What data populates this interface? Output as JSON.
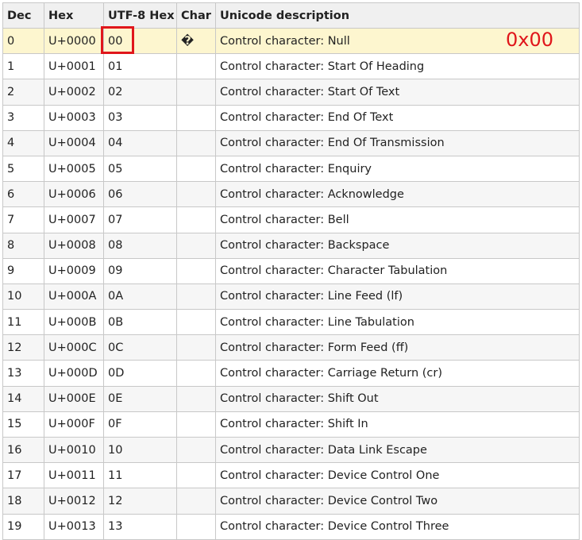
{
  "table": {
    "headers": [
      "Dec",
      "Hex",
      "UTF-8 Hex",
      "Char",
      "Unicode description"
    ],
    "rows": [
      [
        "0",
        "U+0000",
        "00",
        "�",
        "Control character: Null"
      ],
      [
        "1",
        "U+0001",
        "01",
        "",
        "Control character: Start Of Heading"
      ],
      [
        "2",
        "U+0002",
        "02",
        "",
        "Control character: Start Of Text"
      ],
      [
        "3",
        "U+0003",
        "03",
        "",
        "Control character: End Of Text"
      ],
      [
        "4",
        "U+0004",
        "04",
        "",
        "Control character: End Of Transmission"
      ],
      [
        "5",
        "U+0005",
        "05",
        "",
        "Control character: Enquiry"
      ],
      [
        "6",
        "U+0006",
        "06",
        "",
        "Control character: Acknowledge"
      ],
      [
        "7",
        "U+0007",
        "07",
        "",
        "Control character: Bell"
      ],
      [
        "8",
        "U+0008",
        "08",
        "",
        "Control character: Backspace"
      ],
      [
        "9",
        "U+0009",
        "09",
        "",
        "Control character: Character Tabulation"
      ],
      [
        "10",
        "U+000A",
        "0A",
        "",
        "Control character: Line Feed (lf)"
      ],
      [
        "11",
        "U+000B",
        "0B",
        "",
        "Control character: Line Tabulation"
      ],
      [
        "12",
        "U+000C",
        "0C",
        "",
        "Control character: Form Feed (ff)"
      ],
      [
        "13",
        "U+000D",
        "0D",
        "",
        "Control character: Carriage Return (cr)"
      ],
      [
        "14",
        "U+000E",
        "0E",
        "",
        "Control character: Shift Out"
      ],
      [
        "15",
        "U+000F",
        "0F",
        "",
        "Control character: Shift In"
      ],
      [
        "16",
        "U+0010",
        "10",
        "",
        "Control character: Data Link Escape"
      ],
      [
        "17",
        "U+0011",
        "11",
        "",
        "Control character: Device Control One"
      ],
      [
        "18",
        "U+0012",
        "12",
        "",
        "Control character: Device Control Two"
      ],
      [
        "19",
        "U+0013",
        "13",
        "",
        "Control character: Device Control Three"
      ]
    ],
    "highlighted_row": 0
  },
  "annotation": {
    "label": "0x00",
    "color": "#e0161b"
  },
  "colors": {
    "header_bg": "#f0f0f0",
    "highlight_bg": "#fdf6cf",
    "stripe_bg": "#f6f6f6",
    "border": "#c8c8c8"
  }
}
